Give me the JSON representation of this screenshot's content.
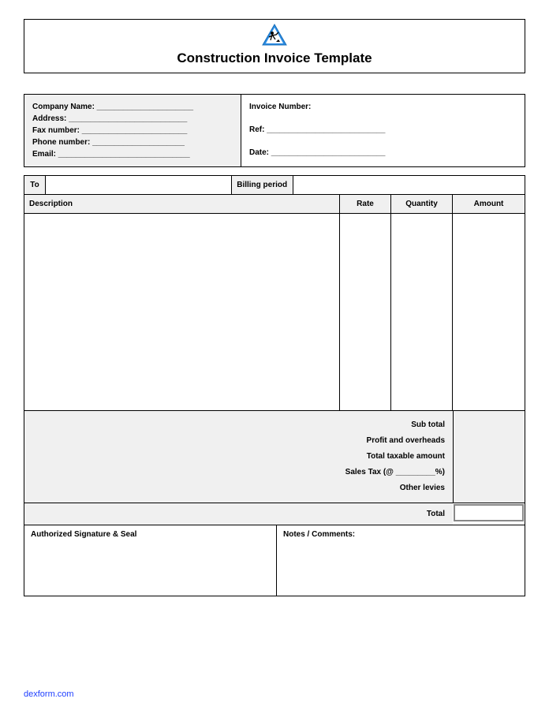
{
  "title": "Construction Invoice Template",
  "company": {
    "name_label": "Company Name: ______________________",
    "address_label": "Address: ___________________________",
    "fax_label": "Fax number: ________________________",
    "phone_label": "Phone number: _____________________",
    "email_label": "Email: ______________________________"
  },
  "invoice": {
    "number_label": "Invoice Number:",
    "ref_label": "Ref: ___________________________",
    "date_label": "Date: __________________________"
  },
  "meta": {
    "to_label": "To",
    "billing_period_label": "Billing period"
  },
  "columns": {
    "description": "Description",
    "rate": "Rate",
    "quantity": "Quantity",
    "amount": "Amount"
  },
  "summary": {
    "subtotal": "Sub total",
    "profit_overheads": "Profit and overheads",
    "total_taxable": "Total taxable amount",
    "sales_tax": "Sales Tax (@ _________%)",
    "other_levies": "Other levies",
    "total": "Total"
  },
  "footer": {
    "signature_label": "Authorized Signature & Seal",
    "notes_label": "Notes / Comments:"
  },
  "source_link": "dexform.com"
}
